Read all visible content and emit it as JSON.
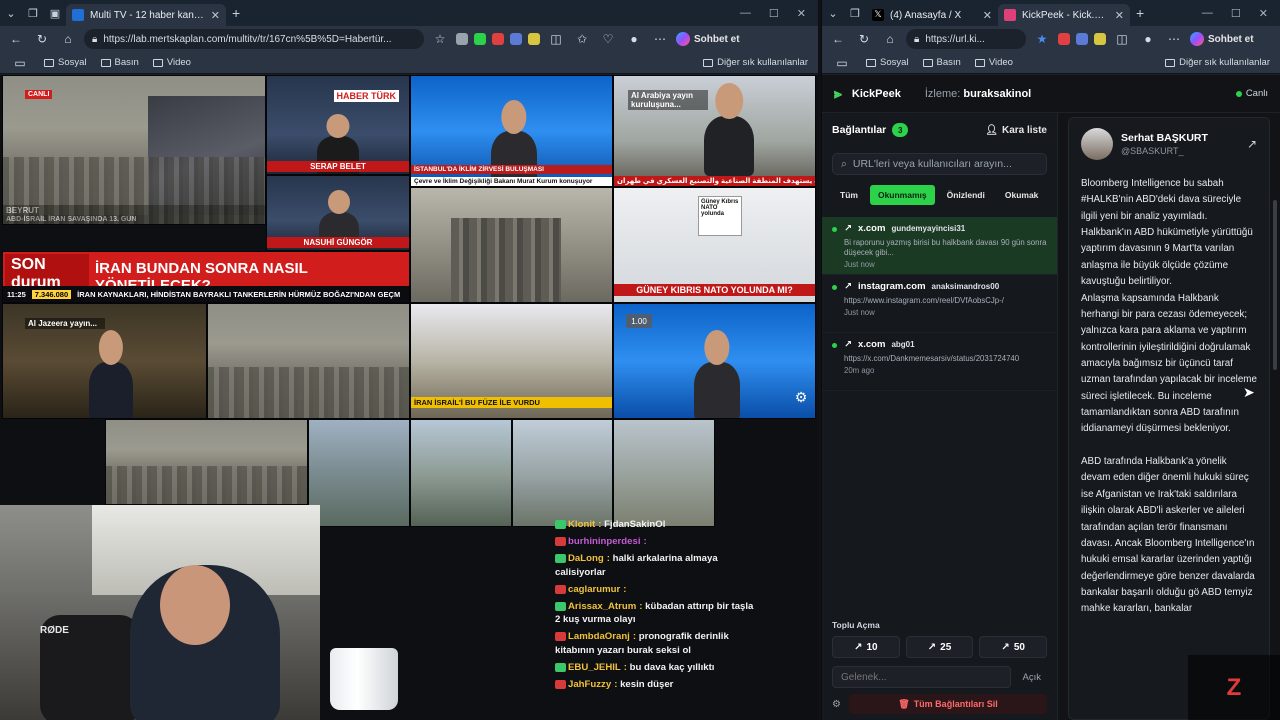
{
  "left_window": {
    "tab_title": "Multi TV - 12 haber kanalını aynı a",
    "url": "https://lab.mertskaplan.com/multitv/tr/167cn%5B%5D=Habertür...",
    "copilot_label": "Sohbet et",
    "bookmarks": [
      "Sosyal",
      "Basın",
      "Video"
    ],
    "other_favorites": "Diğer sık kullanılanlar",
    "tiles": {
      "live_badge": "CANLI",
      "haberturk_logo": "HABER TÜRK",
      "location_beyrut": "BEYRUT",
      "caption_war": "ABD-İSRAİL İRAN SAVAŞINDA 13. GÜN",
      "presenter_serap": "SERAP BELET",
      "presenter_nasuhi": "NASUHİ GÜNGÖR",
      "son_durum": "SON durum",
      "headline_iran": "İRAN BUNDAN SONRA NASIL YÖNETİLECEK?",
      "time_counter": "11:25",
      "count_value": "7.346.080",
      "ticker_iran": "İRAN KAYNAKLARI, HİNDİSTAN BAYRAKLI TANKERLERİN HÜRMÜZ BOĞAZI'NDAN GEÇM",
      "ntv_caption": "İSTANBUL'DA İKLİM ZİRVESİ BULUŞMASI",
      "ntv_ticker": "Çevre ve İklim Değişikliği Bakanı Murat Kurum konuşuyor",
      "al_arabiya": "Al Arabiya yayın kuruluşuna...",
      "arabic_caption": "قصف يستهدف المنطقة الصناعية والتصنيع العسكري في طهران",
      "cyprus_headline": "GÜNEY KIBRIS NATO YOLUNDA MI?",
      "paper_headline": "Güney Kıbrıs NATO yolunda",
      "al_jazeera": "Al Jazeera yayın...",
      "israel_caption": "İRAN İSRAİL'İ BU FÜZE İLE VURDU",
      "speed_badge": "1.00"
    },
    "chat": [
      {
        "user": "Klonit",
        "msg": "FjdanSakinOl",
        "color": "#f0c23a"
      },
      {
        "user": "burhininperdesi",
        "msg": "",
        "color": "#c45ad6"
      },
      {
        "user": "DaLong",
        "msg": "halki arkalarina almaya calisiyorlar",
        "color": "#f0c23a"
      },
      {
        "user": "caglarumur",
        "msg": "",
        "color": "#f0c23a"
      },
      {
        "user": "Arissax_Atrum",
        "msg": "kübadan attırıp bir taşla 2 kuş vurma olayı",
        "color": "#f0c23a"
      },
      {
        "user": "LambdaOranj",
        "msg": "pronografik derinlik kitabının yazarı burak seksi ol",
        "color": "#f0c23a"
      },
      {
        "user": "EBU_JEHIL",
        "msg": "bu dava kaç yıllıktı",
        "color": "#f0c23a"
      },
      {
        "user": "JahFuzzy",
        "msg": "kesin düşer",
        "color": "#f0c23a"
      }
    ]
  },
  "right_window": {
    "tab1_title": "(4) Anasayfa / X",
    "tab2_title": "KickPeek - Kick.com için G",
    "url": "https://url.ki...",
    "copilot_label": "Sohbet et",
    "bookmarks": [
      "Sosyal",
      "Basın",
      "Video"
    ],
    "other_favorites": "Diğer sık kullanılanlar",
    "app_name": "KickPeek",
    "watching_label": "İzleme:",
    "watching_user": "buraksakinol",
    "live_label": "Canlı",
    "connections_label": "Bağlantılar",
    "connections_count": "3",
    "blacklist_label": "Kara liste",
    "search_placeholder": "URL'leri veya kullanıcıları arayın...",
    "filters": [
      "Tüm",
      "Okunmamış",
      "Önizlendi",
      "Okumak"
    ],
    "links": [
      {
        "domain": "x.com",
        "user": "gundemyayincisi31",
        "desc": "Bi raporunu yazmış birisi bu halkbank davası 90 gün sonra düşecek gibi...",
        "time": "Just now"
      },
      {
        "domain": "instagram.com",
        "user": "anaksimandros00",
        "desc": "https://www.instagram.com/reel/DVfAobsCJp-/",
        "time": "Just now"
      },
      {
        "domain": "x.com",
        "user": "abg01",
        "desc": "https://x.com/Dankmemesarsiv/status/2031724740",
        "time": "20m ago"
      }
    ],
    "bulk_label": "Toplu Açma",
    "bulk_buttons": [
      "10",
      "25",
      "50"
    ],
    "goto_placeholder": "Gelenek...",
    "open_label": "Açık",
    "clear_label": "Tüm Bağlantıları Sil",
    "tweet": {
      "name": "Serhat BAŞKURT",
      "handle": "@SBASKURT_",
      "body": "Bloomberg Intelligence bu sabah #HALKB'nin ABD'deki dava süreciyle ilgili yeni bir analiz yayımladı. Halkbank'ın ABD hükümetiyle yürüttüğü yaptırım davasının 9 Mart'ta varılan anlaşma ile büyük ölçüde çözüme kavuştuğu belirtiliyor.\nAnlaşma kapsamında Halkbank herhangi bir para cezası ödemeyecek; yalnızca kara para aklama ve yaptırım kontrollerinin iyileştirildiğini doğrulamak amacıyla bağımsız bir üçüncü taraf uzman tarafından yapılacak bir inceleme süreci işletilecek. Bu inceleme tamamlandıktan sonra ABD tarafının iddianameyi düşürmesi bekleniyor.\n\nABD tarafında Halkbank'a yönelik devam eden diğer önemli hukuki süreç ise Afganistan ve Irak'taki saldırılara ilişkin olarak ABD'li askerler ve aileleri tarafından açılan terör finansmanı davası. Ancak Bloomberg Intelligence'ın hukuki emsal kararlar üzerinden yaptığı değerlendirmeye göre benzer davalarda bankalar başarılı olduğu gö ABD temyiz mahke kararları, bankalar"
    }
  },
  "colors": {
    "accent_green": "#2bd24a",
    "chat_gold": "#f0c23a",
    "danger": "#ff6a6a"
  }
}
